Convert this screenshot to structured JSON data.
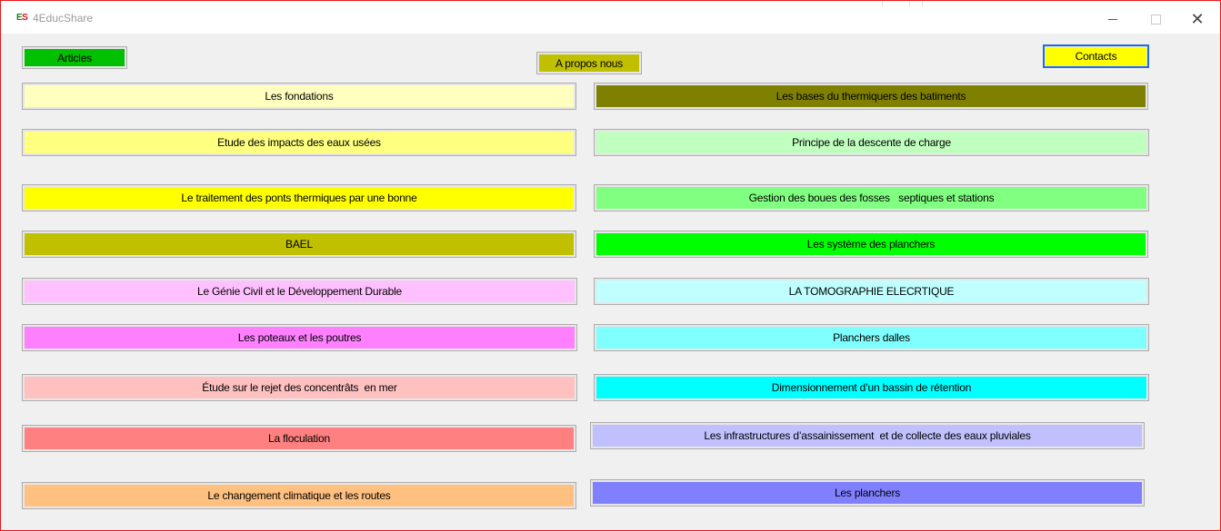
{
  "window": {
    "title": "4EducShare",
    "icon_letters": {
      "e": "E",
      "s": "S"
    },
    "border_color": "#e8161a",
    "controls": {
      "minimize": "minimize-icon",
      "maximize": "maximize-icon",
      "close": "close-icon",
      "close_glyph": "✕"
    }
  },
  "top_buttons": [
    {
      "label": "Articles",
      "color": "#00c000"
    },
    {
      "label": "A propos nous",
      "color": "#c0c000"
    },
    {
      "label": "Contacts",
      "color": "#ffff00"
    }
  ],
  "left_column": [
    {
      "label": "Les fondations",
      "color": "#ffffc0"
    },
    {
      "label": "Etude des impacts des eaux usées",
      "color": "#ffff80"
    },
    {
      "label": "Le traitement des ponts thermiques par une bonne",
      "color": "#ffff00"
    },
    {
      "label": "BAEL",
      "color": "#c0c000"
    },
    {
      "label": "Le Génie Civil et le Développement Durable",
      "color": "#ffc0ff"
    },
    {
      "label": "Les poteaux et les poutres",
      "color": "#ff80ff"
    },
    {
      "label": "Étude sur le rejet des concentrâts  en mer",
      "color": "#ffc0c0"
    },
    {
      "label": "La floculation",
      "color": "#ff8080"
    },
    {
      "label": "Le changement climatique et les routes",
      "color": "#ffc080"
    }
  ],
  "right_column": [
    {
      "label": "Les bases du thermiquers des batiments",
      "color": "#808000"
    },
    {
      "label": "Principe de la descente de charge",
      "color": "#c0ffc0"
    },
    {
      "label": "Gestion des boues des fosses   septiques et stations",
      "color": "#80ff80"
    },
    {
      "label": "Les système des planchers",
      "color": "#00ff00"
    },
    {
      "label": "LA TOMOGRAPHIE ELECRTIQUE",
      "color": "#c0ffff"
    },
    {
      "label": "Planchers dalles",
      "color": "#80ffff"
    },
    {
      "label": "Dimensionnement d’un bassin de rétention",
      "color": "#00ffff"
    },
    {
      "label": "Les infrastructures d’assainissement  et de collecte des eaux pluviales",
      "color": "#c0c0ff"
    },
    {
      "label": "Les planchers",
      "color": "#8080ff"
    }
  ]
}
